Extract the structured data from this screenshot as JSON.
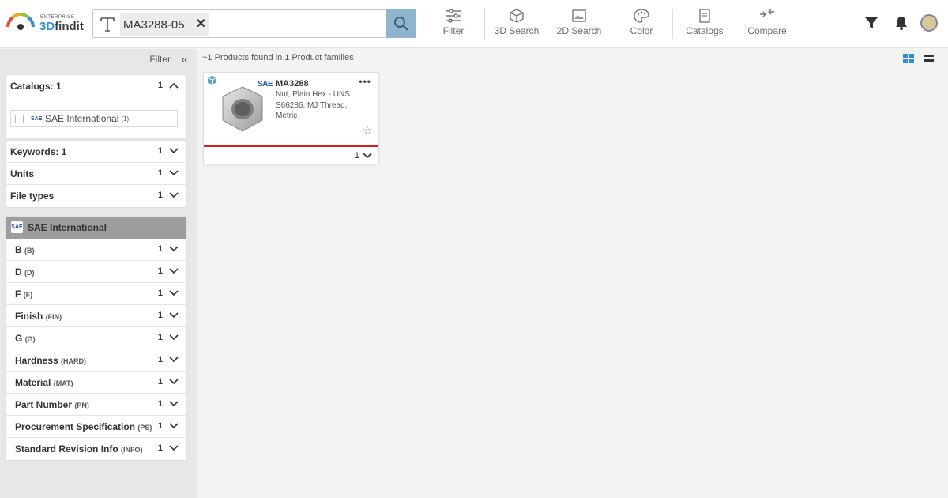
{
  "header": {
    "logo_top": "ENTERPRISE",
    "logo_main_a": "3D",
    "logo_main_b": "findit",
    "search_chip": "MA3288-05",
    "search_value": ""
  },
  "toolbar": [
    {
      "label": "Filter",
      "icon": "sliders-icon"
    },
    {
      "label": "3D Search",
      "icon": "cube-icon"
    },
    {
      "label": "2D Search",
      "icon": "image-icon"
    },
    {
      "label": "Color",
      "icon": "palette-icon"
    },
    {
      "label": "Catalogs",
      "icon": "book-icon"
    },
    {
      "label": "Compare",
      "icon": "compare-arrows-icon"
    }
  ],
  "sidebar": {
    "filter_label": "Filter",
    "catalogs": {
      "label": "Catalogs: 1",
      "count": "1",
      "item": "SAE International",
      "item_count": "(1)"
    },
    "filters": [
      {
        "label": "Keywords: 1",
        "count": "1"
      },
      {
        "label": "Units",
        "count": "1"
      },
      {
        "label": "File types",
        "count": "1"
      }
    ],
    "sae_section": {
      "title": "SAE International",
      "attributes": [
        {
          "label": "B",
          "code": "(B)",
          "count": "1"
        },
        {
          "label": "D",
          "code": "(D)",
          "count": "1"
        },
        {
          "label": "F",
          "code": "(F)",
          "count": "1"
        },
        {
          "label": "Finish",
          "code": "(FIN)",
          "count": "1"
        },
        {
          "label": "G",
          "code": "(G)",
          "count": "1"
        },
        {
          "label": "Hardness",
          "code": "(HARD)",
          "count": "1"
        },
        {
          "label": "Material",
          "code": "(MAT)",
          "count": "1"
        },
        {
          "label": "Part Number",
          "code": "(PN)",
          "count": "1"
        },
        {
          "label": "Procurement Specification",
          "code": "(PS)",
          "count": "1"
        },
        {
          "label": "Standard Revision Info",
          "code": "(INFO)",
          "count": "1"
        }
      ]
    }
  },
  "results": {
    "summary": "~1 Products found in 1 Product families",
    "product": {
      "name": "MA3288",
      "description": "Nut, Plain Hex - UNS S66286, MJ Thread, Metric",
      "brand": "SAE",
      "more": "•••",
      "variant_count": "1"
    }
  }
}
